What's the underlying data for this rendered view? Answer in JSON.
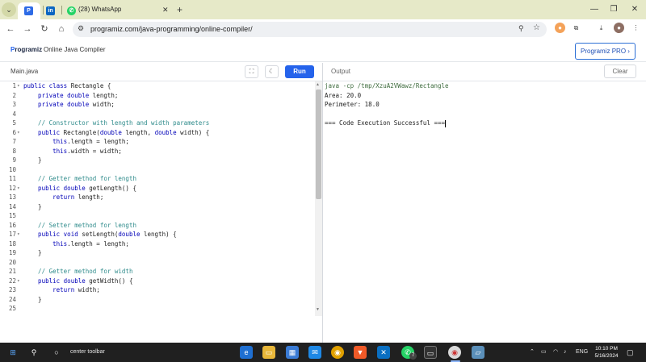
{
  "browser": {
    "tabs": [
      {
        "label": "",
        "active": true
      },
      {
        "label": "",
        "active": false
      },
      {
        "label": "(28) WhatsApp",
        "active": false
      }
    ],
    "tab_close": "✕",
    "new_tab": "+",
    "window_controls": {
      "minimize": "—",
      "restore": "❐",
      "close": "✕"
    },
    "nav": {
      "back": "←",
      "forward": "→",
      "reload": "↻",
      "home": "⌂"
    },
    "url": "programiz.com/java-programming/online-compiler/"
  },
  "site": {
    "logo_brand": "P",
    "logo_rest": "rogramiz",
    "title": "Online Java Compiler",
    "pro_button": "Programiz PRO ›"
  },
  "editor": {
    "file_name": "Main.java",
    "run_label": "Run",
    "fullscreen_glyph": "⛶",
    "theme_glyph": "☾",
    "lines": [
      {
        "n": "1",
        "fold": true
      },
      {
        "n": "2",
        "fold": false
      },
      {
        "n": "3",
        "fold": false
      },
      {
        "n": "4",
        "fold": false
      },
      {
        "n": "5",
        "fold": false
      },
      {
        "n": "6",
        "fold": true
      },
      {
        "n": "7",
        "fold": false
      },
      {
        "n": "8",
        "fold": false
      },
      {
        "n": "9",
        "fold": false
      },
      {
        "n": "10",
        "fold": false
      },
      {
        "n": "11",
        "fold": false
      },
      {
        "n": "12",
        "fold": true
      },
      {
        "n": "13",
        "fold": false
      },
      {
        "n": "14",
        "fold": false
      },
      {
        "n": "15",
        "fold": false
      },
      {
        "n": "16",
        "fold": false
      },
      {
        "n": "17",
        "fold": true
      },
      {
        "n": "18",
        "fold": false
      },
      {
        "n": "19",
        "fold": false
      },
      {
        "n": "20",
        "fold": false
      },
      {
        "n": "21",
        "fold": false
      },
      {
        "n": "22",
        "fold": true
      },
      {
        "n": "23",
        "fold": false
      },
      {
        "n": "24",
        "fold": false
      },
      {
        "n": "25",
        "fold": false
      }
    ],
    "code": [
      [
        {
          "t": "public class",
          "c": "kw"
        },
        {
          "t": " Rectangle {",
          "c": ""
        }
      ],
      [
        {
          "t": "    private double",
          "c": "kw"
        },
        {
          "t": " length;",
          "c": ""
        }
      ],
      [
        {
          "t": "    private double",
          "c": "kw"
        },
        {
          "t": " width;",
          "c": ""
        }
      ],
      [],
      [
        {
          "t": "    // Constructor with length and width parameters",
          "c": "cm"
        }
      ],
      [
        {
          "t": "    public",
          "c": "kw"
        },
        {
          "t": " Rectangle(",
          "c": ""
        },
        {
          "t": "double",
          "c": "kw"
        },
        {
          "t": " length, ",
          "c": ""
        },
        {
          "t": "double",
          "c": "kw"
        },
        {
          "t": " width) {",
          "c": ""
        }
      ],
      [
        {
          "t": "        this",
          "c": "kw"
        },
        {
          "t": ".length = length;",
          "c": ""
        }
      ],
      [
        {
          "t": "        this",
          "c": "kw"
        },
        {
          "t": ".width = width;",
          "c": ""
        }
      ],
      [
        {
          "t": "    }",
          "c": ""
        }
      ],
      [],
      [
        {
          "t": "    // Getter method for length",
          "c": "cm"
        }
      ],
      [
        {
          "t": "    public double",
          "c": "kw"
        },
        {
          "t": " getLength() {",
          "c": ""
        }
      ],
      [
        {
          "t": "        return",
          "c": "kw"
        },
        {
          "t": " length;",
          "c": ""
        }
      ],
      [
        {
          "t": "    }",
          "c": ""
        }
      ],
      [],
      [
        {
          "t": "    // Setter method for length",
          "c": "cm"
        }
      ],
      [
        {
          "t": "    public void",
          "c": "kw"
        },
        {
          "t": " setLength(",
          "c": ""
        },
        {
          "t": "double",
          "c": "kw"
        },
        {
          "t": " length) {",
          "c": ""
        }
      ],
      [
        {
          "t": "        this",
          "c": "kw"
        },
        {
          "t": ".length = length;",
          "c": ""
        }
      ],
      [
        {
          "t": "    }",
          "c": ""
        }
      ],
      [],
      [
        {
          "t": "    // Getter method for width",
          "c": "cm"
        }
      ],
      [
        {
          "t": "    public double",
          "c": "kw"
        },
        {
          "t": " getWidth() {",
          "c": ""
        }
      ],
      [
        {
          "t": "        return",
          "c": "kw"
        },
        {
          "t": " width;",
          "c": ""
        }
      ],
      [
        {
          "t": "    }",
          "c": ""
        }
      ],
      []
    ]
  },
  "output": {
    "title": "Output",
    "clear_label": "Clear",
    "lines": [
      "java -cp /tmp/XzuA2VWawz/Rectangle",
      "Area: 20.0",
      "Perimeter: 18.0",
      "",
      "=== Code Execution Successful ==="
    ]
  },
  "taskbar": {
    "search_text": "center toolbar",
    "language": "ENG",
    "time": "10:10 PM",
    "date": "5/16/2024",
    "whatsapp_badge": "7"
  },
  "colors": {
    "accent": "#2563eb",
    "keyword": "#0000b8",
    "comment": "#2e8b8b",
    "taskbar": "#202020",
    "tabstrip": "#e6e9c8"
  }
}
